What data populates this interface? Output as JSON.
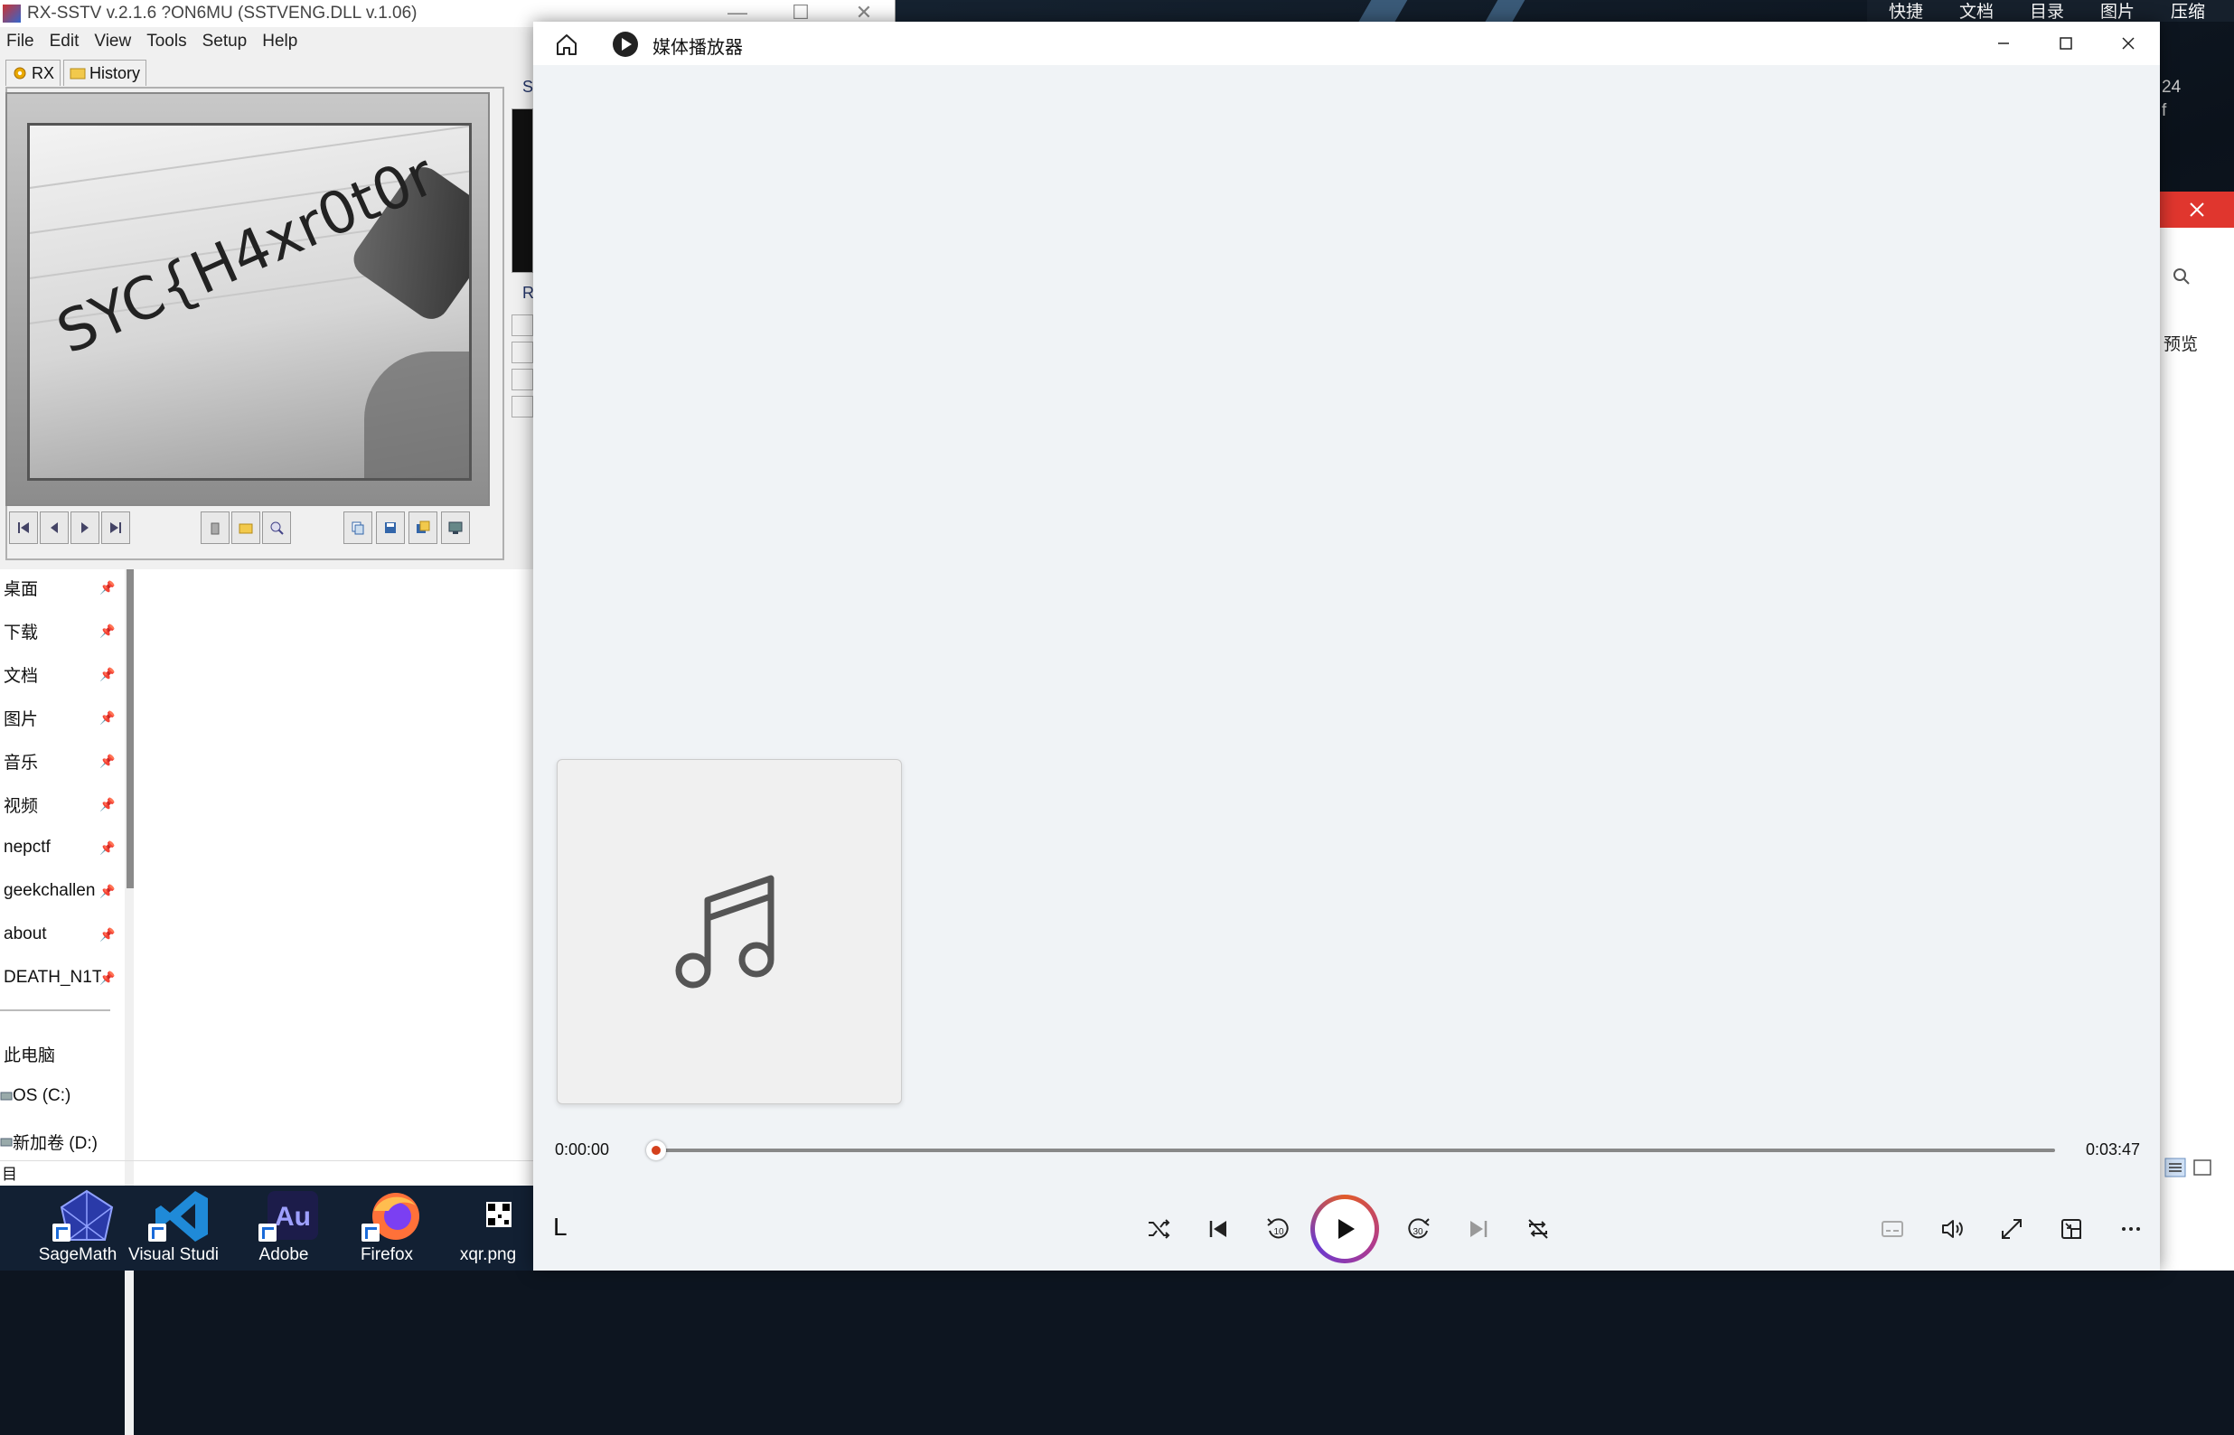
{
  "sstv": {
    "title": "RX-SSTV v.2.1.6 ?ON6MU (SSTVENG.DLL v.1.06)",
    "menu": [
      "File",
      "Edit",
      "View",
      "Tools",
      "Setup",
      "Help"
    ],
    "tabs": [
      {
        "label": "RX",
        "icon": "gear-icon"
      },
      {
        "label": "History",
        "icon": "folder-icon"
      }
    ],
    "image_text": "SYC{H4xr0t0r",
    "side_label": "S",
    "side_label2": "R"
  },
  "explorer": {
    "quick_access": [
      {
        "label": "桌面"
      },
      {
        "label": "下载"
      },
      {
        "label": "文档"
      },
      {
        "label": "图片"
      },
      {
        "label": "音乐"
      },
      {
        "label": "视频"
      },
      {
        "label": "nepctf"
      },
      {
        "label": "geekchallen"
      },
      {
        "label": "about"
      },
      {
        "label": "DEATH_N1T"
      }
    ],
    "this_pc": "此电脑",
    "drives": [
      {
        "label": "OS (C:)"
      },
      {
        "label": "新加卷 (D:)"
      }
    ],
    "bottom_text": "目"
  },
  "taskbar": {
    "items": [
      {
        "label": "SageMath",
        "icon": "sagemath-icon"
      },
      {
        "label": "Visual Studio",
        "icon": "vscode-icon"
      },
      {
        "label": "Adobe",
        "icon": "audition-icon"
      },
      {
        "label": "Firefox",
        "icon": "firefox-icon"
      },
      {
        "label": "xqr.png",
        "icon": "qr-icon"
      }
    ]
  },
  "player": {
    "app_title": "媒体播放器",
    "current_time": "0:00:00",
    "total_time": "0:03:47",
    "progress": 0.005,
    "track_title": "L",
    "skip_back_seconds": "10",
    "skip_forward_seconds": "30",
    "accent_color": "#d4401c"
  },
  "right": {
    "menu": [
      "快捷",
      "文档",
      "目录",
      "图片",
      "压缩"
    ],
    "text1": "24",
    "text2": "f",
    "preview": "预览"
  }
}
